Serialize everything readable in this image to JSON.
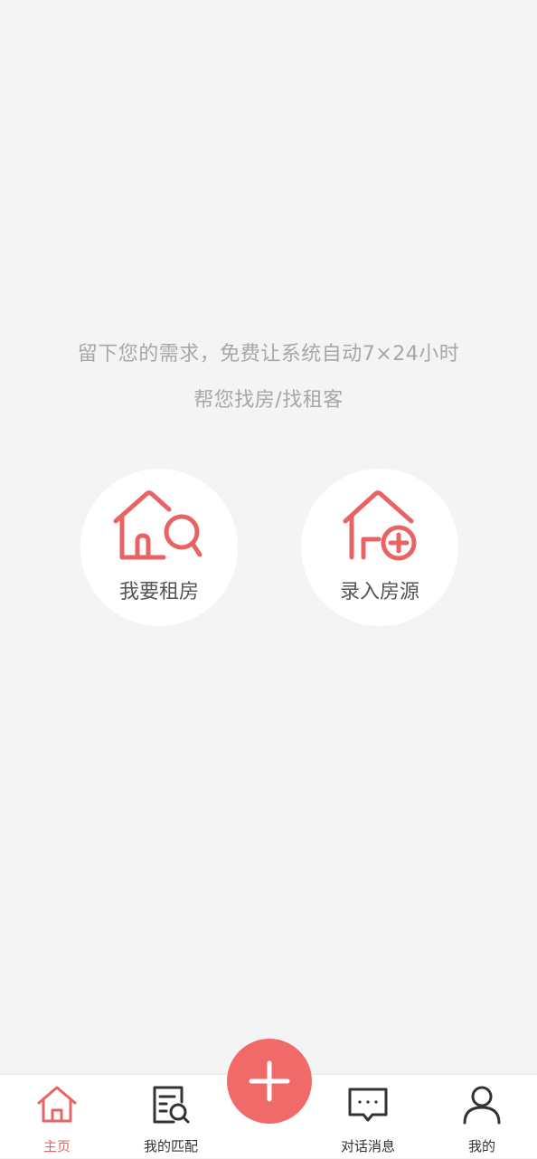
{
  "prompt": {
    "line1": "留下您的需求，免费让系统自动7×24小时",
    "line2": "帮您找房/找租客"
  },
  "actions": {
    "rent": {
      "label": "我要租房",
      "icon": "house-search-icon"
    },
    "list": {
      "label": "录入房源",
      "icon": "house-add-icon"
    }
  },
  "tabbar": {
    "tabs": [
      {
        "label": "主页",
        "icon": "home-icon",
        "active": true
      },
      {
        "label": "我的匹配",
        "icon": "document-search-icon",
        "active": false
      },
      {
        "label": "对话消息",
        "icon": "chat-bubble-icon",
        "active": false
      },
      {
        "label": "我的",
        "icon": "user-icon",
        "active": false
      }
    ],
    "fab": {
      "icon": "plus-icon"
    }
  },
  "colors": {
    "accent": "#f16a6a",
    "icon_accent": "#e86464",
    "background": "#f4f4f4",
    "text_muted": "#a7a7a7",
    "text_dark": "#333333"
  }
}
